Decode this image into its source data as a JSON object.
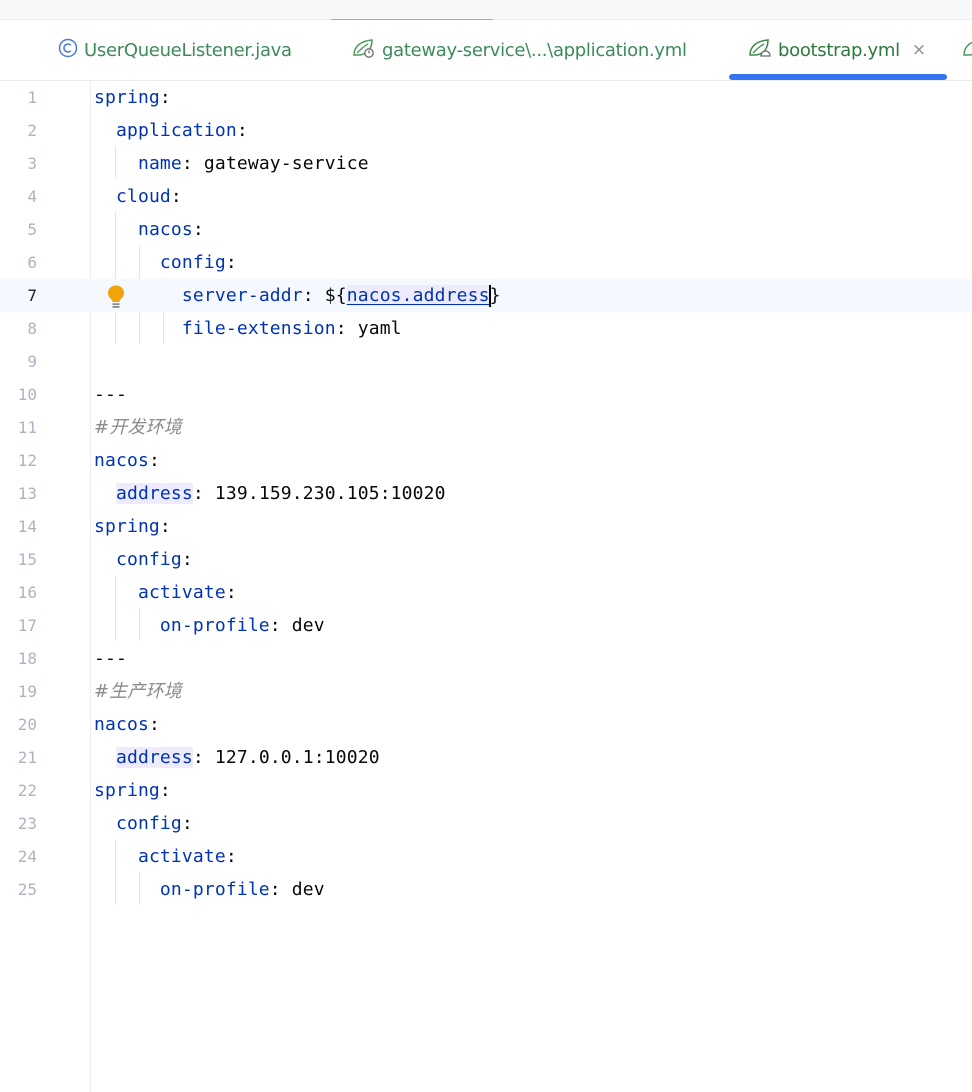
{
  "tabs": [
    {
      "label": "UserQueueListener.java",
      "icon": "class-icon"
    },
    {
      "label": "gateway-service\\...\\application.yml",
      "icon": "spring-config-icon"
    },
    {
      "label": "bootstrap.yml",
      "icon": "spring-config-icon",
      "active": true,
      "close": "×"
    },
    {
      "label": "",
      "icon": "spring-config-icon"
    }
  ],
  "editor": {
    "current_line": 7,
    "line_numbers": [
      "1",
      "2",
      "3",
      "4",
      "5",
      "6",
      "7",
      "8",
      "9",
      "10",
      "11",
      "12",
      "13",
      "14",
      "15",
      "16",
      "17",
      "18",
      "19",
      "20",
      "21",
      "22",
      "23",
      "24",
      "25"
    ],
    "tokens": {
      "l1": {
        "key": "spring",
        "colon": ":"
      },
      "l2": {
        "key": "application",
        "colon": ":"
      },
      "l3": {
        "key": "name",
        "colon": ": ",
        "value": "gateway-service"
      },
      "l4": {
        "key": "cloud",
        "colon": ":"
      },
      "l5": {
        "key": "nacos",
        "colon": ":"
      },
      "l6": {
        "key": "config",
        "colon": ":"
      },
      "l7": {
        "key": "server-addr",
        "colon": ": ",
        "prefix": "${",
        "ref": "nacos.address",
        "suffix": "}"
      },
      "l8": {
        "key": "file-extension",
        "colon": ": ",
        "value": "yaml"
      },
      "l10": {
        "text": "---"
      },
      "l11": {
        "comment": "#开发环境"
      },
      "l12": {
        "key": "nacos",
        "colon": ":"
      },
      "l13": {
        "key": "address",
        "colon": ": ",
        "value": "139.159.230.105:10020"
      },
      "l14": {
        "key": "spring",
        "colon": ":"
      },
      "l15": {
        "key": "config",
        "colon": ":"
      },
      "l16": {
        "key": "activate",
        "colon": ":"
      },
      "l17": {
        "key": "on-profile",
        "colon": ": ",
        "value": "dev"
      },
      "l18": {
        "text": "---"
      },
      "l19": {
        "comment": "#生产环境"
      },
      "l20": {
        "key": "nacos",
        "colon": ":"
      },
      "l21": {
        "key": "address",
        "colon": ": ",
        "value": "127.0.0.1:10020"
      },
      "l22": {
        "key": "spring",
        "colon": ":"
      },
      "l23": {
        "key": "config",
        "colon": ":"
      },
      "l24": {
        "key": "activate",
        "colon": ":"
      },
      "l25": {
        "key": "on-profile",
        "colon": ": ",
        "value": "dev"
      }
    }
  },
  "colors": {
    "keyword": "#0033b3",
    "comment": "#8c8c8c",
    "accent": "#3574f0",
    "bulb": "#f0a30a"
  }
}
